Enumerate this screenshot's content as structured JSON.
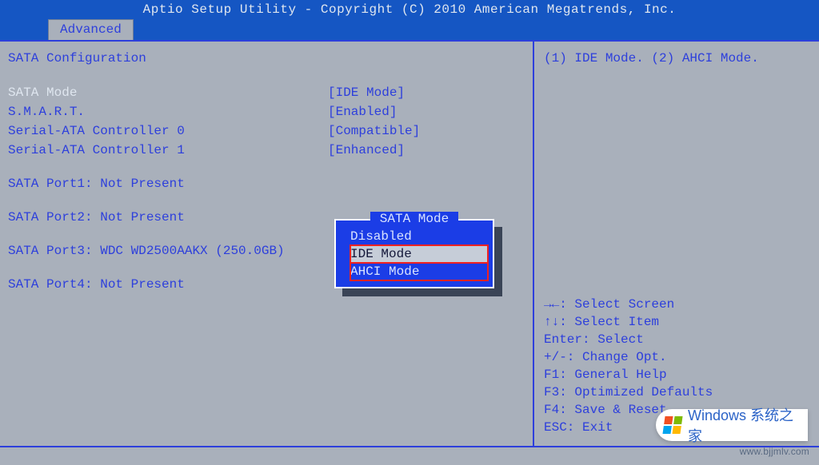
{
  "header": {
    "title": "Aptio Setup Utility - Copyright (C) 2010 American Megatrends, Inc."
  },
  "menu": {
    "active_tab": "Advanced"
  },
  "section": {
    "title": "SATA Configuration"
  },
  "settings": [
    {
      "label": "SATA Mode",
      "value": "[IDE Mode]",
      "selected": true
    },
    {
      "label": "S.M.A.R.T.",
      "value": "[Enabled]",
      "selected": false
    },
    {
      "label": "Serial-ATA Controller 0",
      "value": "[Compatible]",
      "selected": false
    },
    {
      "label": "Serial-ATA Controller 1",
      "value": "[Enhanced]",
      "selected": false
    }
  ],
  "ports": [
    "SATA Port1: Not Present",
    "SATA Port2: Not Present",
    "SATA Port3: WDC WD2500AAKX (250.0GB)",
    "SATA Port4: Not Present"
  ],
  "popup": {
    "title": "SATA Mode",
    "options": [
      {
        "text": "Disabled",
        "selected": false,
        "highlight": false
      },
      {
        "text": "IDE Mode",
        "selected": true,
        "highlight": true
      },
      {
        "text": "AHCI Mode",
        "selected": false,
        "highlight": true
      }
    ]
  },
  "help": {
    "top": "(1) IDE Mode. (2) AHCI Mode.",
    "keys": [
      "→←: Select Screen",
      "↑↓: Select Item",
      "Enter: Select",
      "+/-: Change Opt.",
      "F1: General Help",
      "F3: Optimized Defaults",
      "F4: Save & Reset",
      "ESC: Exit"
    ]
  },
  "watermark": {
    "brand": "Windows 系统之家",
    "url": "www.bjjmlv.com"
  }
}
